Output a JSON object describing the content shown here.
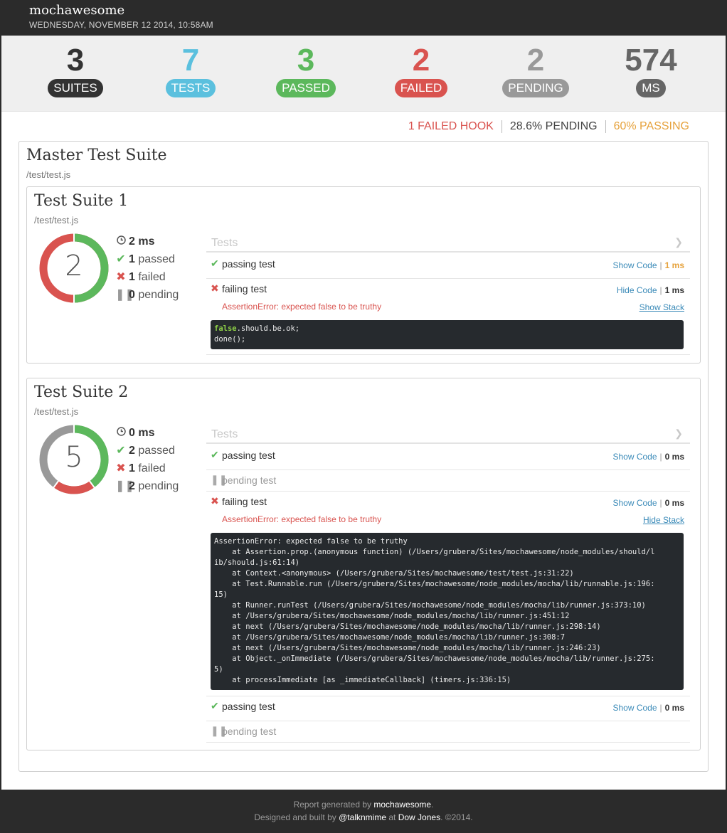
{
  "header": {
    "brand": "mochawesome",
    "date": "WEDNESDAY, NOVEMBER 12 2014, 10:58AM"
  },
  "stats": [
    {
      "value": "3",
      "label": "SUITES",
      "color": "#333333"
    },
    {
      "value": "7",
      "label": "TESTS",
      "color": "#5bc0de"
    },
    {
      "value": "3",
      "label": "PASSED",
      "color": "#5cb85c"
    },
    {
      "value": "2",
      "label": "FAILED",
      "color": "#d9534f"
    },
    {
      "value": "2",
      "label": "PENDING",
      "color": "#999999"
    },
    {
      "value": "574",
      "label": "MS",
      "color": "#666666"
    }
  ],
  "quick": {
    "failed_hook": "1 FAILED HOOK",
    "pending": "28.6% PENDING",
    "passing": "60% PASSING"
  },
  "master": {
    "title": "Master Test Suite",
    "file": "/test/test.js"
  },
  "suites": [
    {
      "title": "Test Suite 1",
      "file": "/test/test.js",
      "total": "2",
      "duration": "2 ms",
      "passed_count": "1",
      "passed_label": "passed",
      "failed_count": "1",
      "failed_label": "failed",
      "pending_count": "0",
      "pending_label": "pending",
      "tests_label": "Tests",
      "tests": [
        {
          "title": "passing test",
          "link": "Show Code",
          "sep": "|",
          "duration": "1 ms"
        },
        {
          "title": "failing test",
          "link": "Hide Code",
          "sep": "|",
          "duration": "1 ms",
          "error": "AssertionError: expected false to be truthy",
          "stack_link": "Show Stack",
          "code_kw": "false",
          "code_rest": ".should.be.ok;\ndone();"
        }
      ]
    },
    {
      "title": "Test Suite 2",
      "file": "/test/test.js",
      "total": "5",
      "duration": "0 ms",
      "passed_count": "2",
      "passed_label": "passed",
      "failed_count": "1",
      "failed_label": "failed",
      "pending_count": "2",
      "pending_label": "pending",
      "tests_label": "Tests",
      "tests": [
        {
          "title": "passing test",
          "link": "Show Code",
          "sep": "|",
          "duration": "0 ms"
        },
        {
          "title": "pending test"
        },
        {
          "title": "failing test",
          "link": "Show Code",
          "sep": "|",
          "duration": "0 ms",
          "error": "AssertionError: expected false to be truthy",
          "stack_link": "Hide Stack",
          "stack": "AssertionError: expected false to be truthy\n    at Assertion.prop.(anonymous function) (/Users/grubera/Sites/mochawesome/node_modules/should/l\nib/should.js:61:14)\n    at Context.<anonymous> (/Users/grubera/Sites/mochawesome/test/test.js:31:22)\n    at Test.Runnable.run (/Users/grubera/Sites/mochawesome/node_modules/mocha/lib/runnable.js:196:\n15)\n    at Runner.runTest (/Users/grubera/Sites/mochawesome/node_modules/mocha/lib/runner.js:373:10)\n    at /Users/grubera/Sites/mochawesome/node_modules/mocha/lib/runner.js:451:12\n    at next (/Users/grubera/Sites/mochawesome/node_modules/mocha/lib/runner.js:298:14)\n    at /Users/grubera/Sites/mochawesome/node_modules/mocha/lib/runner.js:308:7\n    at next (/Users/grubera/Sites/mochawesome/node_modules/mocha/lib/runner.js:246:23)\n    at Object._onImmediate (/Users/grubera/Sites/mochawesome/node_modules/mocha/lib/runner.js:275:\n5)\n    at processImmediate [as _immediateCallback] (timers.js:336:15)"
        },
        {
          "title": "passing test",
          "link": "Show Code",
          "sep": "|",
          "duration": "0 ms"
        },
        {
          "title": "pending test"
        }
      ]
    }
  ],
  "footer": {
    "line1_pre": "Report generated by",
    "line1_name": "mochawesome",
    "line1_post": ".",
    "line2_pre": "Designed and built by",
    "line2_author": "@talknmime",
    "line2_at": "at",
    "line2_company": "Dow Jones",
    "line2_post": ". ©2014."
  },
  "colors": {
    "pass": "#5cb85c",
    "fail": "#d9534f",
    "pending": "#999999"
  }
}
